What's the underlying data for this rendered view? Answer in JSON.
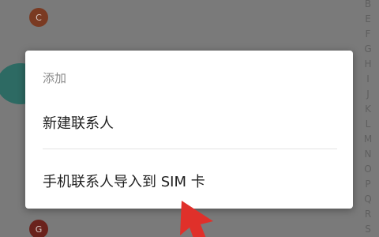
{
  "contacts": {
    "avatar_c": "C",
    "avatar_g": "G"
  },
  "index_letters": [
    "B",
    "E",
    "F",
    "G",
    "H",
    "I",
    "J",
    "K",
    "L",
    "M",
    "N",
    "O",
    "P",
    "Q",
    "R",
    "S"
  ],
  "dialog": {
    "title": "添加",
    "items": [
      {
        "label": "新建联系人"
      },
      {
        "label": "手机联系人导入到 SIM 卡"
      }
    ]
  },
  "colors": {
    "overlay_bg": "#7a7a7a",
    "dialog_bg": "#ffffff",
    "arrow": "#e0302a"
  },
  "icons": [
    "red-arrow-annotation"
  ]
}
